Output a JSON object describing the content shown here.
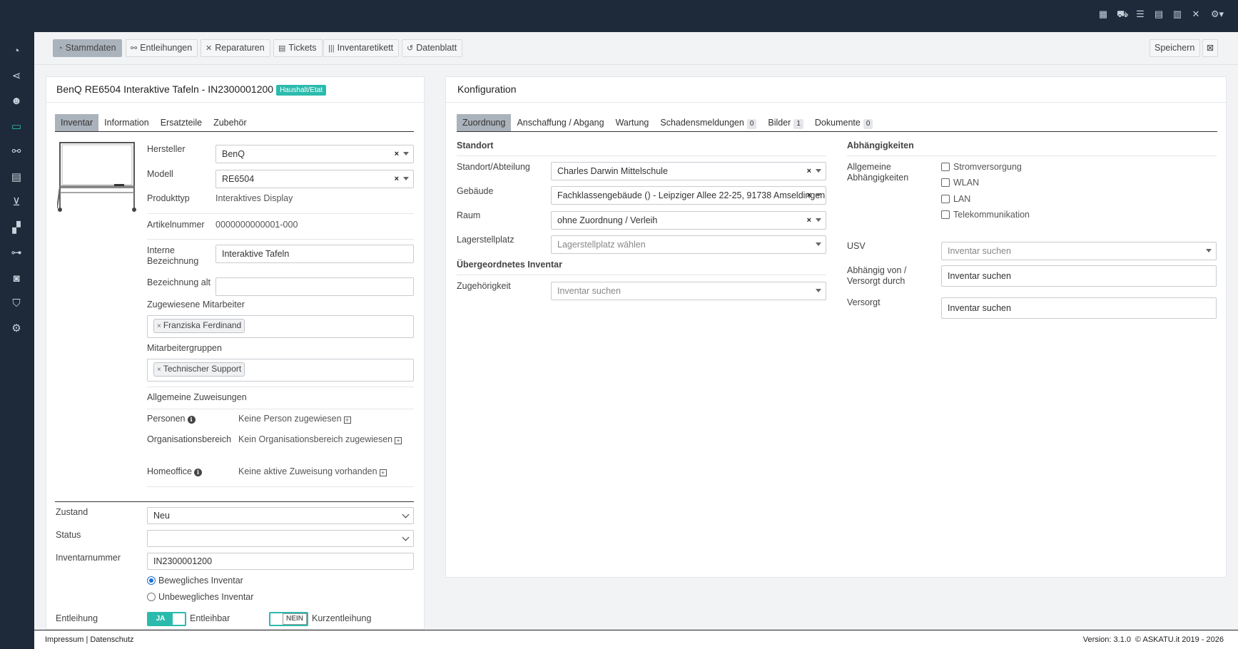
{
  "toolbar": {
    "tabs": [
      {
        "label": "Stammdaten",
        "icon": "dashboard-icon"
      },
      {
        "label": "Entleihungen",
        "icon": "handshake-icon"
      },
      {
        "label": "Reparaturen",
        "icon": "tools-icon"
      },
      {
        "label": "Tickets",
        "icon": "ticket-icon"
      },
      {
        "label": "Inventaretikett",
        "icon": "barcode-icon"
      },
      {
        "label": "Datenblatt",
        "icon": "history-icon"
      }
    ],
    "save_label": "Speichern"
  },
  "left": {
    "title": "BenQ RE6504 Interaktive Tafeln - IN2300001200",
    "badge": "Haushalt/Etat",
    "tabs": [
      "Inventar",
      "Information",
      "Ersatzteile",
      "Zubehör"
    ],
    "hersteller_label": "Hersteller",
    "hersteller_value": "BenQ",
    "modell_label": "Modell",
    "modell_value": "RE6504",
    "produkttyp_label": "Produkttyp",
    "produkttyp_value": "Interaktives Display",
    "artikelnummer_label": "Artikelnummer",
    "artikelnummer_value": "0000000000001-000",
    "interne_label_1": "Interne",
    "interne_label_2": "Bezeichnung",
    "interne_value": "Interaktive Tafeln",
    "bez_alt_label": "Bezeichnung alt",
    "bez_alt_value": "",
    "mitarbeiter_label": "Zugewiesene Mitarbeiter",
    "mitarbeiter_tag": "Franziska Ferdinand",
    "gruppen_label": "Mitarbeitergruppen",
    "gruppen_tag": "Technischer Support",
    "allg_label": "Allgemeine Zuweisungen",
    "personen_label": "Personen",
    "personen_value": "Keine Person zugewiesen",
    "org_label": "Organisationsbereich",
    "org_value": "Kein Organisationsbereich zugewiesen",
    "home_label": "Homeoffice",
    "home_value": "Keine aktive Zuweisung vorhanden",
    "zustand_label": "Zustand",
    "zustand_value": "Neu",
    "status_label": "Status",
    "status_value": "",
    "inv_label": "Inventarnummer",
    "inv_value": "IN2300001200",
    "radio_1": "Bewegliches Inventar",
    "radio_2": "Unbewegliches Inventar",
    "entleihung_label": "Entleihung",
    "toggle_on": "JA",
    "entleihbar": "Entleihbar",
    "toggle_off": "NEIN",
    "kurzentleihung": "Kurzentleihung"
  },
  "right": {
    "title": "Konfiguration",
    "tabs": [
      {
        "label": "Zuordnung",
        "count": ""
      },
      {
        "label": "Anschaffung / Abgang",
        "count": ""
      },
      {
        "label": "Wartung",
        "count": ""
      },
      {
        "label": "Schadensmeldungen",
        "count": "0"
      },
      {
        "label": "Bilder",
        "count": "1"
      },
      {
        "label": "Dokumente",
        "count": "0"
      }
    ],
    "standort_section": "Standort",
    "standort_label": "Standort/Abteilung",
    "standort_value": "Charles Darwin Mittelschule",
    "gebaeude_label": "Gebäude",
    "gebaeude_value": "Fachklassengebäude () - Leipziger Allee 22-25, 91738 Amseldingen",
    "raum_label": "Raum",
    "raum_value": "ohne Zuordnung / Verleih",
    "lager_label": "Lagerstellplatz",
    "lager_placeholder": "Lagerstellplatz wählen",
    "ueber_section": "Übergeordnetes Inventar",
    "zugeh_label": "Zugehörigkeit",
    "zugeh_placeholder": "Inventar suchen",
    "abh_section": "Abhängigkeiten",
    "allg_abh_1": "Allgemeine",
    "allg_abh_2": "Abhängigkeiten",
    "checks": [
      "Stromversorgung",
      "WLAN",
      "LAN",
      "Telekommunikation"
    ],
    "usv_label": "USV",
    "usv_placeholder": "Inventar suchen",
    "abh_von_1": "Abhängig von /",
    "abh_von_2": "Versorgt durch",
    "abh_von_placeholder": "Inventar suchen",
    "versorgt_label": "Versorgt",
    "versorgt_placeholder": "Inventar suchen"
  },
  "footer": {
    "links": "Impressum | Datenschutz",
    "version": "Version: 3.1.0",
    "copyright": "© ASKATU.it 2019 - 2026"
  },
  "colors": {
    "accent": "#2bbbad",
    "nav": "#1e2a3a"
  }
}
